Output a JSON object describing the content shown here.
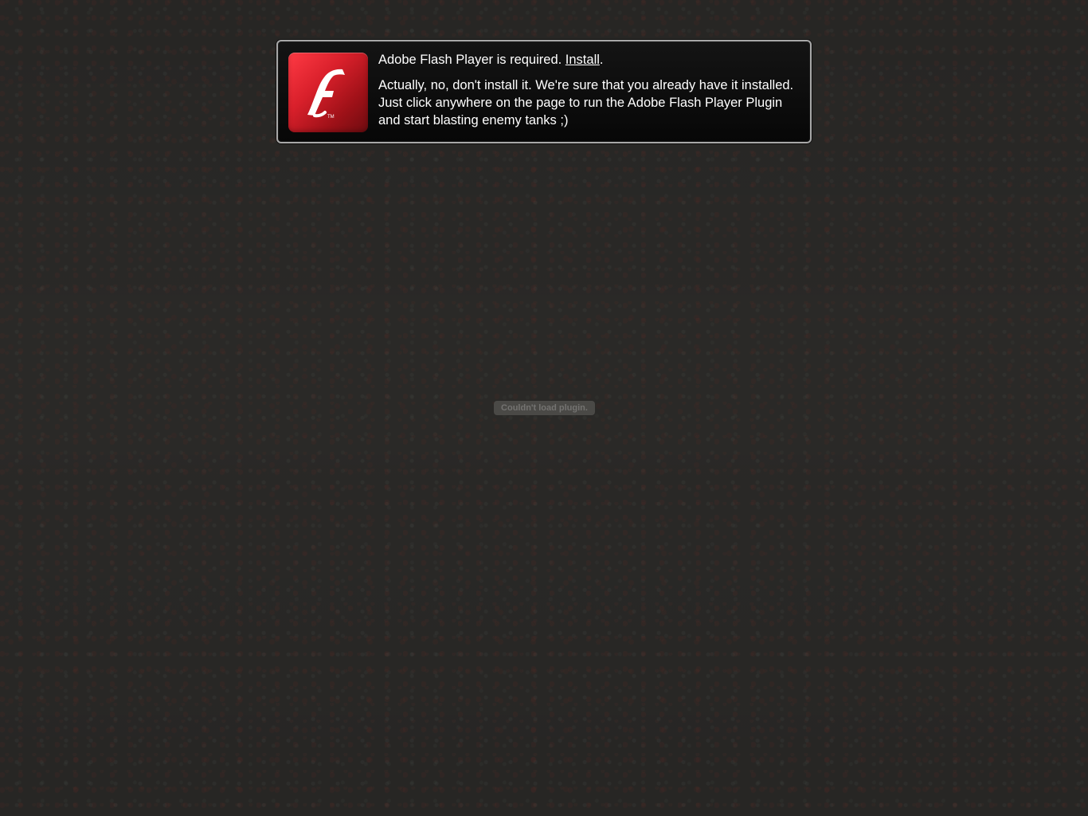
{
  "notice": {
    "line1_prefix": "Adobe Flash Player is required.",
    "install_label": "Install",
    "line1_suffix": ".",
    "line2": "Actually, no, don't install it. We're sure that you already have it installed. Just click anywhere on the page to run the Adobe Flash Player Plugin and start blasting enemy tanks ;)"
  },
  "logo": {
    "letter": "f",
    "trademark": "TM",
    "icon": "adobe-flash-player-icon"
  },
  "plugin_status": {
    "text": "Couldn't load plugin."
  },
  "colors": {
    "background": "#2b2a28",
    "notice_background": "#0b0b0b",
    "notice_border": "#a8a8a8",
    "logo_red": "#d9202b",
    "text": "#ffffff"
  }
}
